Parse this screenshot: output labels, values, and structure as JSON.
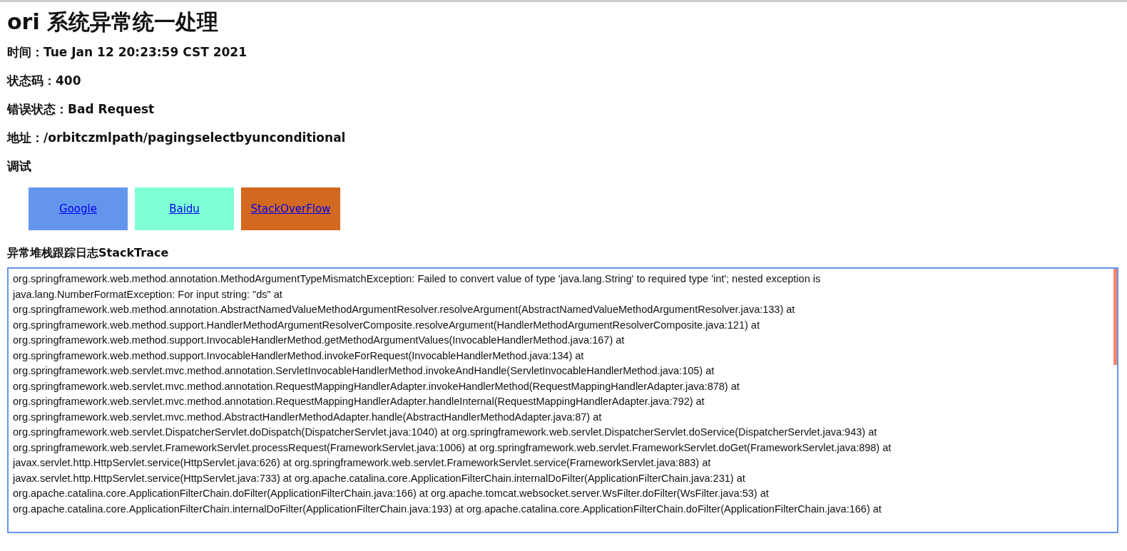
{
  "title": "ori 系统异常统一处理",
  "info": [
    {
      "label": "时间：",
      "value": "Tue Jan 12 20:23:59 CST 2021"
    },
    {
      "label": "状态码：",
      "value": "400"
    },
    {
      "label": "错误状态：",
      "value": "Bad Request"
    },
    {
      "label": "地址：",
      "value": "/orbitczmlpath/pagingselectbyunconditional"
    }
  ],
  "debug_heading": "调试",
  "links": [
    {
      "label": "Google",
      "color": "#6495ed"
    },
    {
      "label": "Baidu",
      "color": "#7fffd4"
    },
    {
      "label": "StackOverFlow",
      "color": "#d2691e"
    }
  ],
  "stack_heading": "异常堆栈跟踪日志StackTrace",
  "stack_lines": [
    "org.springframework.web.method.annotation.MethodArgumentTypeMismatchException: Failed to convert value of type 'java.lang.String' to required type 'int'; nested exception is",
    "java.lang.NumberFormatException: For input string: \"ds\" at",
    "org.springframework.web.method.annotation.AbstractNamedValueMethodArgumentResolver.resolveArgument(AbstractNamedValueMethodArgumentResolver.java:133) at",
    "org.springframework.web.method.support.HandlerMethodArgumentResolverComposite.resolveArgument(HandlerMethodArgumentResolverComposite.java:121) at",
    "org.springframework.web.method.support.InvocableHandlerMethod.getMethodArgumentValues(InvocableHandlerMethod.java:167) at",
    "org.springframework.web.method.support.InvocableHandlerMethod.invokeForRequest(InvocableHandlerMethod.java:134) at",
    "org.springframework.web.servlet.mvc.method.annotation.ServletInvocableHandlerMethod.invokeAndHandle(ServletInvocableHandlerMethod.java:105) at",
    "org.springframework.web.servlet.mvc.method.annotation.RequestMappingHandlerAdapter.invokeHandlerMethod(RequestMappingHandlerAdapter.java:878) at",
    "org.springframework.web.servlet.mvc.method.annotation.RequestMappingHandlerAdapter.handleInternal(RequestMappingHandlerAdapter.java:792) at",
    "org.springframework.web.servlet.mvc.method.AbstractHandlerMethodAdapter.handle(AbstractHandlerMethodAdapter.java:87) at",
    "org.springframework.web.servlet.DispatcherServlet.doDispatch(DispatcherServlet.java:1040) at org.springframework.web.servlet.DispatcherServlet.doService(DispatcherServlet.java:943) at",
    "org.springframework.web.servlet.FrameworkServlet.processRequest(FrameworkServlet.java:1006) at org.springframework.web.servlet.FrameworkServlet.doGet(FrameworkServlet.java:898) at",
    "javax.servlet.http.HttpServlet.service(HttpServlet.java:626) at org.springframework.web.servlet.FrameworkServlet.service(FrameworkServlet.java:883) at",
    "javax.servlet.http.HttpServlet.service(HttpServlet.java:733) at org.apache.catalina.core.ApplicationFilterChain.internalDoFilter(ApplicationFilterChain.java:231) at",
    "org.apache.catalina.core.ApplicationFilterChain.doFilter(ApplicationFilterChain.java:166) at org.apache.tomcat.websocket.server.WsFilter.doFilter(WsFilter.java:53) at",
    "org.apache.catalina.core.ApplicationFilterChain.internalDoFilter(ApplicationFilterChain.java:193) at org.apache.catalina.core.ApplicationFilterChain.doFilter(ApplicationFilterChain.java:166) at"
  ]
}
